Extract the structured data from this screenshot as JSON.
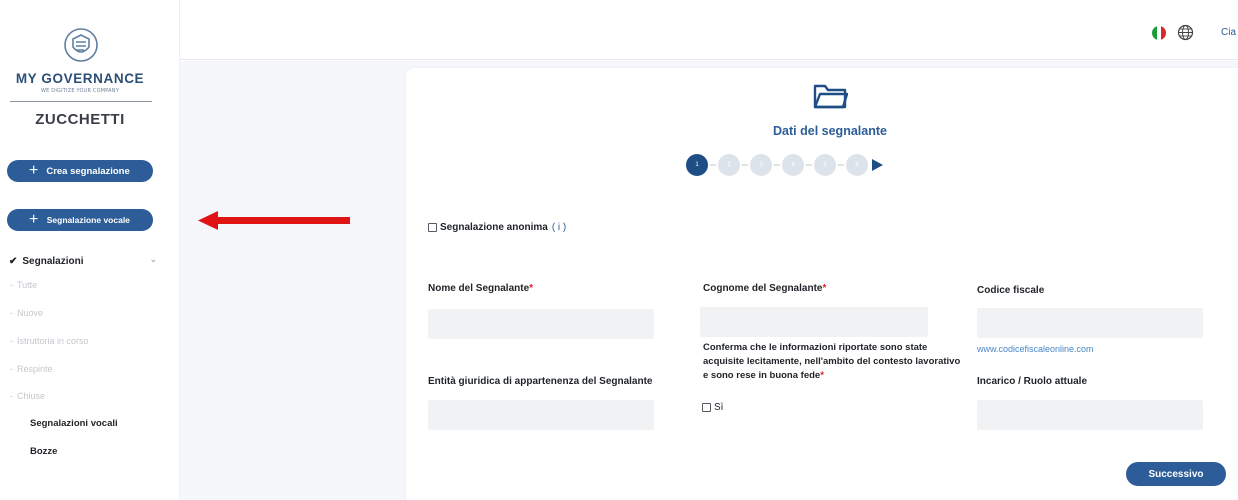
{
  "brand": {
    "name": "MY GOVERNANCE",
    "tagline": "WE DIGITIZE YOUR COMPANY",
    "company": "ZUCCHETTI",
    "logo_icon": "shield-logo-icon"
  },
  "sidebar": {
    "create_button": "Crea segnalazione",
    "voice_button": "Segnalazione vocale",
    "section_title": "Segnalazioni",
    "items": [
      "Tutte",
      "Nuove",
      "Istruttoria in corso",
      "Respinte",
      "Chiuse"
    ],
    "voice_reports": "Segnalazioni vocali",
    "drafts": "Bozze"
  },
  "header": {
    "greeting": "Cia",
    "language_icon": "italian-flag-icon",
    "globe_icon": "globe-icon"
  },
  "form": {
    "step_title": "Dati del segnalante",
    "steps": [
      "1",
      "2",
      "3",
      "4",
      "5",
      "6"
    ],
    "active_step": 1,
    "anonymous_label": "Segnalazione anonima",
    "anonymous_info": "( i )",
    "labels": {
      "first_name": "Nome del Segnalante",
      "last_name": "Cognome del Segnalante",
      "tax_code": "Codice fiscale",
      "legal_entity": "Entità giuridica di appartenenza del Segnalante",
      "role": "Incarico / Ruolo attuale",
      "required_mark": "*"
    },
    "confirm_text": "Conferma che le informazioni riportate sono state acquisite lecitamente, nell'ambito del contesto lavorativo e sono rese in buona fede",
    "confirm_option": "Sì",
    "tax_code_link": "www.codicefiscaleonline.com",
    "next_button": "Successivo"
  },
  "colors": {
    "primary": "#2d5d98",
    "step_active": "#1f4e86",
    "step_inactive": "#dde3ea",
    "annotation_arrow": "#e01414",
    "required": "#e11d1d"
  }
}
